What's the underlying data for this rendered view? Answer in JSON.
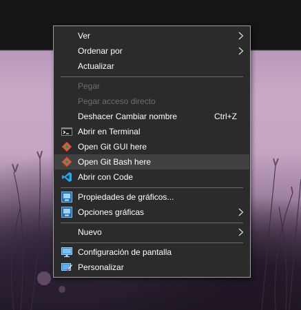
{
  "context_menu": {
    "items": [
      {
        "label": "Ver",
        "submenu": true
      },
      {
        "label": "Ordenar por",
        "submenu": true
      },
      {
        "label": "Actualizar"
      },
      {
        "label": "Pegar",
        "disabled": true
      },
      {
        "label": "Pegar acceso directo",
        "disabled": true
      },
      {
        "label": "Deshacer Cambiar nombre",
        "shortcut": "Ctrl+Z"
      },
      {
        "label": "Abrir en Terminal",
        "icon": "terminal-icon"
      },
      {
        "label": "Open Git GUI here",
        "icon": "git-icon"
      },
      {
        "label": "Open Git Bash here",
        "icon": "git-icon",
        "hovered": true
      },
      {
        "label": "Abrir con Code",
        "icon": "vscode-icon"
      },
      {
        "label": "Propiedades de gráficos...",
        "icon": "intel-graphics-icon"
      },
      {
        "label": "Opciones gráficas",
        "icon": "intel-graphics-icon",
        "submenu": true
      },
      {
        "label": "Nuevo",
        "submenu": true
      },
      {
        "label": "Configuración de pantalla",
        "icon": "display-settings-icon"
      },
      {
        "label": "Personalizar",
        "icon": "personalize-icon"
      }
    ]
  },
  "colors": {
    "menu_background": "#2b2b2b",
    "hover_background": "#414141",
    "disabled_text": "#6d6d6d",
    "separator": "#6a6a6a",
    "git_orange": "#f05033",
    "vscode_blue": "#23a9f2"
  }
}
